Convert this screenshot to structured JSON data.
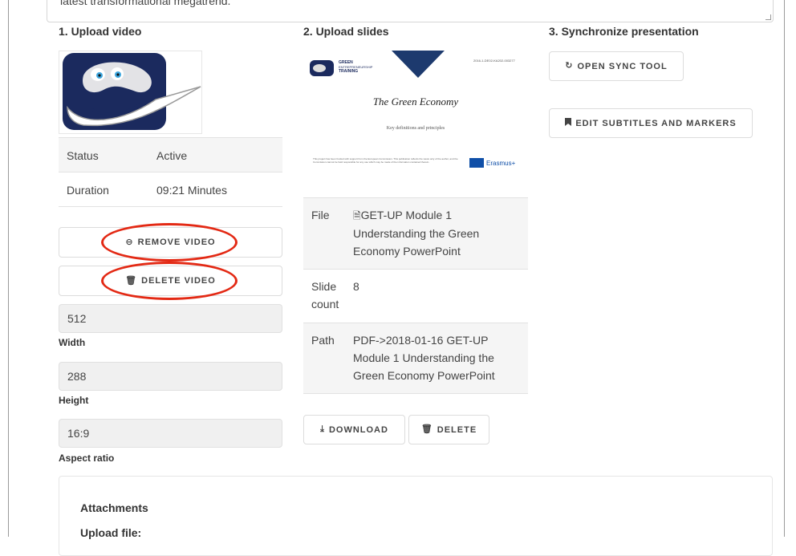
{
  "top_textarea": {
    "text": "latest transformational megatrend."
  },
  "upload_video": {
    "title": "1. Upload video",
    "info": [
      {
        "key": "Status",
        "value": "Active"
      },
      {
        "key": "Duration",
        "value": "09:21 Minutes"
      }
    ],
    "remove_label": "REMOVE VIDEO",
    "delete_label": "DELETE VIDEO",
    "width": {
      "value": "512",
      "label": "Width"
    },
    "height": {
      "value": "288",
      "label": "Height"
    },
    "aspect": {
      "value": "16:9",
      "label": "Aspect ratio"
    }
  },
  "upload_slides": {
    "title": "2. Upload slides",
    "thumb": {
      "logo_line1": "GREEN",
      "logo_line2": "ENTREPRENEURSHIP",
      "logo_line3": "TRAINING",
      "project_code": "2016-1-DE02-KA202-003277",
      "heading": "The Green Economy",
      "subheading": "Key definitions and principles",
      "disclaimer": "This project has been funded with support from the European Commission. This publication reflects the views only of the author, and the Commission cannot be held responsible for any use which may be made of the information contained therein.",
      "erasmus": "Erasmus+"
    },
    "rows": [
      {
        "key": "File",
        "value": "GET-UP Module 1 Understanding the Green Economy PowerPoint"
      },
      {
        "key": "Slide count",
        "value": "8"
      },
      {
        "key": "Path",
        "value": "PDF->2018-01-16 GET-UP Module 1 Understanding the Green Economy PowerPoint"
      }
    ],
    "download_label": "DOWNLOAD",
    "delete_label": "DELETE"
  },
  "sync": {
    "title": "3. Synchronize presentation",
    "open_sync_label": "OPEN SYNC TOOL",
    "edit_subtitles_label": "EDIT SUBTITLES AND MARKERS"
  },
  "attachments": {
    "title": "Attachments",
    "upload_label": "Upload file:"
  },
  "colors": {
    "annotation_red": "#e32914",
    "eu_blue": "#0f4fa8",
    "logo_navy": "#1b2a5e",
    "slide_navy": "#1d3a6e"
  },
  "icons": {
    "remove": "minus-circle-icon",
    "delete": "trash-icon",
    "open_sync": "refresh-icon",
    "edit_subtitles": "bookmark-icon",
    "download": "download-icon",
    "file": "file-icon"
  }
}
